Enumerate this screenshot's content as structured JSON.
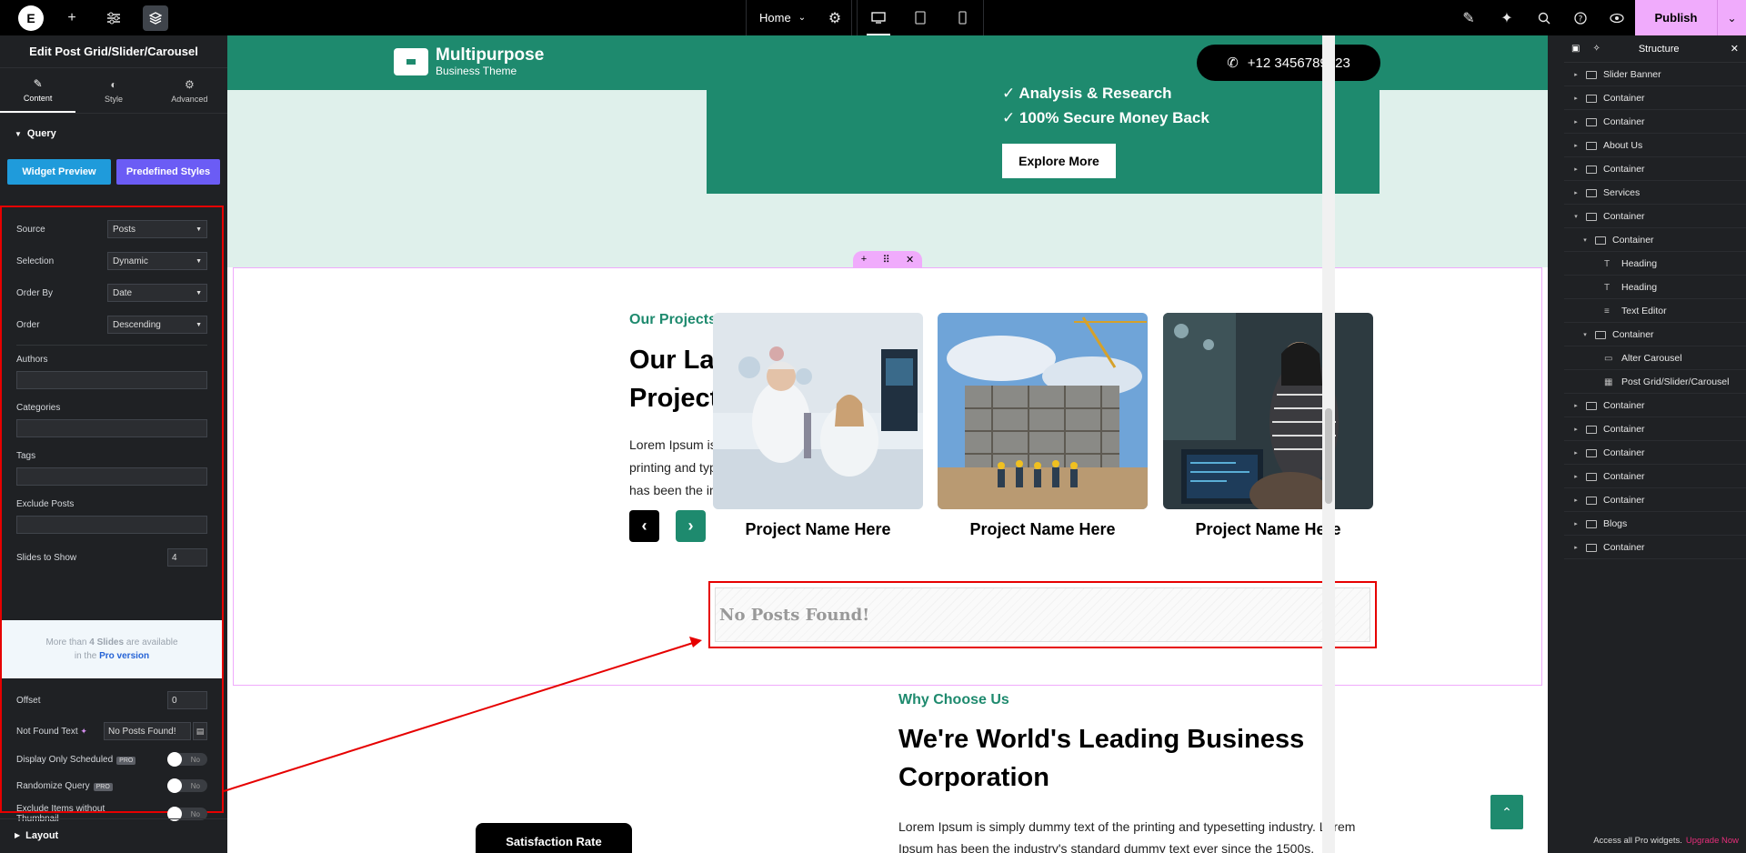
{
  "topbar": {
    "page_name": "Home",
    "publish_label": "Publish"
  },
  "left_panel": {
    "title": "Edit Post Grid/Slider/Carousel",
    "tabs": [
      {
        "label": "Content"
      },
      {
        "label": "Style"
      },
      {
        "label": "Advanced"
      }
    ],
    "section_query": "Query",
    "btn_widget_preview": "Widget Preview",
    "btn_predefined_styles": "Predefined Styles",
    "controls": {
      "source": {
        "label": "Source",
        "value": "Posts"
      },
      "selection": {
        "label": "Selection",
        "value": "Dynamic"
      },
      "order_by": {
        "label": "Order By",
        "value": "Date"
      },
      "order": {
        "label": "Order",
        "value": "Descending"
      },
      "authors": {
        "label": "Authors"
      },
      "categories": {
        "label": "Categories"
      },
      "tags": {
        "label": "Tags"
      },
      "exclude_posts": {
        "label": "Exclude Posts"
      },
      "slides_to_show": {
        "label": "Slides to Show",
        "value": "4"
      },
      "pro_notice": {
        "line1_pre": "More than ",
        "line1_bold": "4 Slides",
        "line1_post": " are available",
        "line2_pre": "in the ",
        "line2_link": "Pro version"
      },
      "offset": {
        "label": "Offset",
        "value": "0"
      },
      "not_found_text": {
        "label": "Not Found Text",
        "value": "No Posts Found!"
      },
      "display_only_scheduled": {
        "label": "Display Only Scheduled",
        "badge": "PRO",
        "toggle": "No"
      },
      "randomize_query": {
        "label": "Randomize Query",
        "badge": "PRO",
        "toggle": "No"
      },
      "exclude_without_thumb": {
        "label": "Exclude Items without Thumbnail",
        "toggle": "No"
      }
    },
    "section_layout": "Layout"
  },
  "canvas": {
    "brand_name": "Multipurpose",
    "brand_sub": "Business Theme",
    "phone": "+12 3456789123",
    "hero_items": [
      "✓ Analysis & Research",
      "✓ 100% Secure Money Back"
    ],
    "explore_label": "Explore More",
    "projects": {
      "label": "Our Projects",
      "title": "Our Latest Success Projects",
      "desc": "Lorem Ipsum is simply dummy text of the printing and typesetting industry. Lorem Ipsum has been the industry's.",
      "prev_glyph": "‹",
      "next_glyph": "›",
      "cards": [
        {
          "name": "Project Name Here"
        },
        {
          "name": "Project Name Here"
        },
        {
          "name": "Project Name Here"
        }
      ]
    },
    "not_found": "No Posts Found!",
    "why": {
      "label": "Why Choose Us",
      "title": "We're World's Leading Business Corporation",
      "desc": "Lorem Ipsum is simply dummy text of the printing and typesetting industry. Lorem Ipsum has been the industry's standard dummy text ever since the 1500s,"
    },
    "satisfaction": "Satisfaction Rate"
  },
  "right_panel": {
    "title": "Structure",
    "tree": [
      {
        "label": "Slider Banner",
        "level": 0,
        "caret": "▸",
        "icon": "box"
      },
      {
        "label": "Container",
        "level": 0,
        "caret": "▸",
        "icon": "box"
      },
      {
        "label": "Container",
        "level": 0,
        "caret": "▸",
        "icon": "box"
      },
      {
        "label": "About Us",
        "level": 0,
        "caret": "▸",
        "icon": "box"
      },
      {
        "label": "Container",
        "level": 0,
        "caret": "▸",
        "icon": "box"
      },
      {
        "label": "Services",
        "level": 0,
        "caret": "▸",
        "icon": "box"
      },
      {
        "label": "Container",
        "level": 0,
        "caret": "▾",
        "icon": "box"
      },
      {
        "label": "Container",
        "level": 1,
        "caret": "▾",
        "icon": "box"
      },
      {
        "label": "Heading",
        "level": 2,
        "caret": "",
        "icon": "T"
      },
      {
        "label": "Heading",
        "level": 2,
        "caret": "",
        "icon": "T"
      },
      {
        "label": "Text Editor",
        "level": 2,
        "caret": "",
        "icon": "≡"
      },
      {
        "label": "Container",
        "level": 1,
        "caret": "▾",
        "icon": "box"
      },
      {
        "label": "Alter Carousel",
        "level": 2,
        "caret": "",
        "icon": "▭"
      },
      {
        "label": "Post Grid/Slider/Carousel",
        "level": 2,
        "caret": "",
        "icon": "▦"
      },
      {
        "label": "Container",
        "level": 0,
        "caret": "▸",
        "icon": "box"
      },
      {
        "label": "Container",
        "level": 0,
        "caret": "▸",
        "icon": "box"
      },
      {
        "label": "Container",
        "level": 0,
        "caret": "▸",
        "icon": "box"
      },
      {
        "label": "Container",
        "level": 0,
        "caret": "▸",
        "icon": "box"
      },
      {
        "label": "Container",
        "level": 0,
        "caret": "▸",
        "icon": "box"
      },
      {
        "label": "Blogs",
        "level": 0,
        "caret": "▸",
        "icon": "box"
      },
      {
        "label": "Container",
        "level": 0,
        "caret": "▸",
        "icon": "box"
      }
    ],
    "footer_text": "Access all Pro widgets.",
    "footer_link": "Upgrade Now"
  },
  "colors": {
    "brand_green": "#1e8a6e",
    "highlight_red": "#e60000",
    "editor_accent": "#f0abfc"
  }
}
